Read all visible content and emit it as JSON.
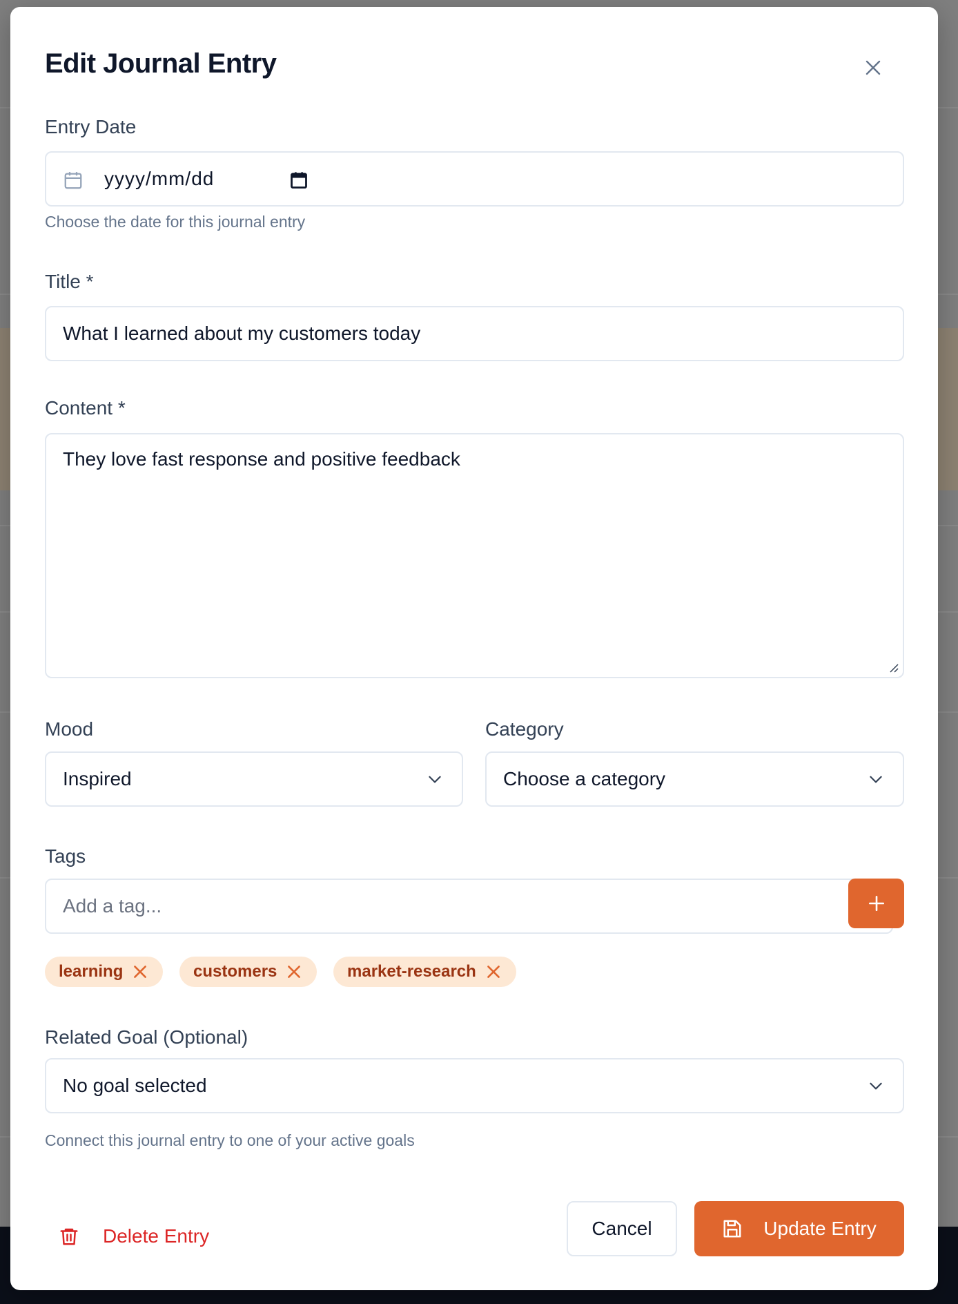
{
  "colors": {
    "accent": "#e0662e",
    "danger": "#dc2626",
    "tag_bg": "#fde8d4",
    "tag_text": "#9a3412"
  },
  "modal": {
    "title": "Edit Journal Entry",
    "close_icon": "close-icon"
  },
  "entry_date": {
    "label": "Entry Date",
    "value": "yyyy/mm/dd",
    "hint": "Choose the date for this journal entry",
    "icons": [
      "calendar-icon",
      "date-picker-icon"
    ]
  },
  "title_field": {
    "label": "Title *",
    "value": "What I learned about my customers today"
  },
  "content_field": {
    "label": "Content *",
    "value": "They love fast response and positive feedback"
  },
  "mood": {
    "label": "Mood",
    "selected": "Inspired",
    "icon": "chevron-down-icon"
  },
  "category": {
    "label": "Category",
    "selected": "Choose a category",
    "icon": "chevron-down-icon"
  },
  "tags": {
    "label": "Tags",
    "placeholder": "Add a tag...",
    "add_icon": "plus-icon",
    "items": [
      "learning",
      "customers",
      "market-research"
    ],
    "remove_icon": "x-icon"
  },
  "related_goal": {
    "label": "Related Goal (Optional)",
    "selected": "No goal selected",
    "hint": "Connect this journal entry to one of your active goals"
  },
  "actions": {
    "delete_label": "Delete Entry",
    "delete_icon": "trash-icon",
    "cancel_label": "Cancel",
    "update_label": "Update Entry",
    "update_icon": "save-icon"
  }
}
